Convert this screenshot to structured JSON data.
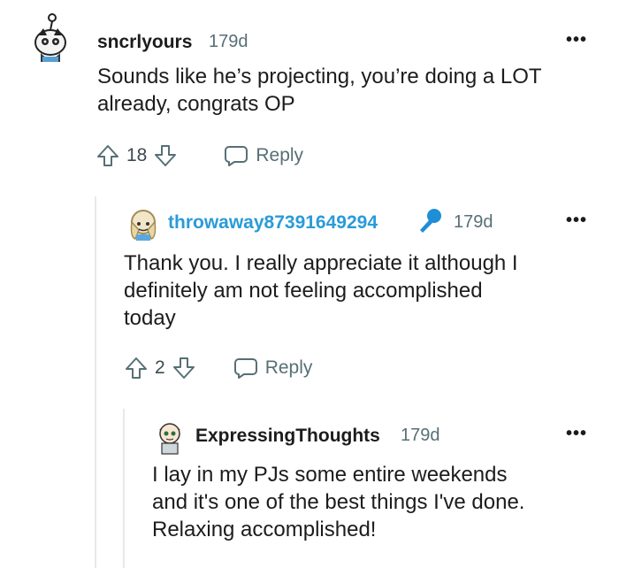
{
  "colors": {
    "text": "#1c1c1c",
    "meta": "#576f76",
    "op_username": "#2a9bd8",
    "op_badge": "#1e8fd6"
  },
  "comments": [
    {
      "username": "sncrlyours",
      "time": "179d",
      "more": "•••",
      "body_lines": [
        "Sounds like he’s projecting, you’re doing a LOT",
        "already, congrats OP"
      ],
      "score": "18",
      "reply_label": "Reply"
    },
    {
      "username": "throwaway87391649294",
      "badge_icon": "microphone-icon",
      "time": "179d",
      "more": "•••",
      "body_lines": [
        "Thank you. I really appreciate it although I",
        "definitely am not feeling accomplished",
        "today"
      ],
      "score": "2",
      "reply_label": "Reply"
    },
    {
      "username": "ExpressingThoughts",
      "time": "179d",
      "more": "•••",
      "body_lines": [
        "I lay in my PJs some entire weekends",
        "and it's one of the best things I've done.",
        "Relaxing accomplished!"
      ]
    }
  ]
}
